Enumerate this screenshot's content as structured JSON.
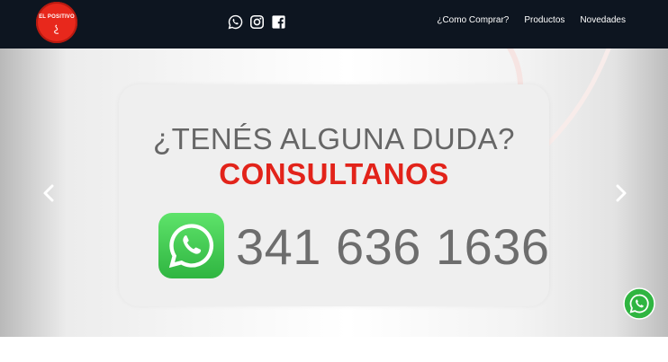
{
  "header": {
    "logo_text": "EL POSITIVO",
    "nav": [
      {
        "label": "¿Como Comprar?"
      },
      {
        "label": "Productos"
      },
      {
        "label": "Novedades"
      }
    ],
    "social_icons": [
      "whatsapp-icon",
      "instagram-icon",
      "facebook-icon"
    ]
  },
  "banner": {
    "headline": "¿TENÉS ALGUNA DUDA?",
    "subheadline": "CONSULTANOS",
    "phone": "341 636 1636",
    "colors": {
      "accent": "#e2231a",
      "whatsapp": "#2fb541",
      "text": "#666666"
    }
  },
  "carousel_controls": {
    "prev_icon": "chevron-left-icon",
    "next_icon": "chevron-right-icon"
  },
  "floating": {
    "icon": "whatsapp-icon"
  }
}
